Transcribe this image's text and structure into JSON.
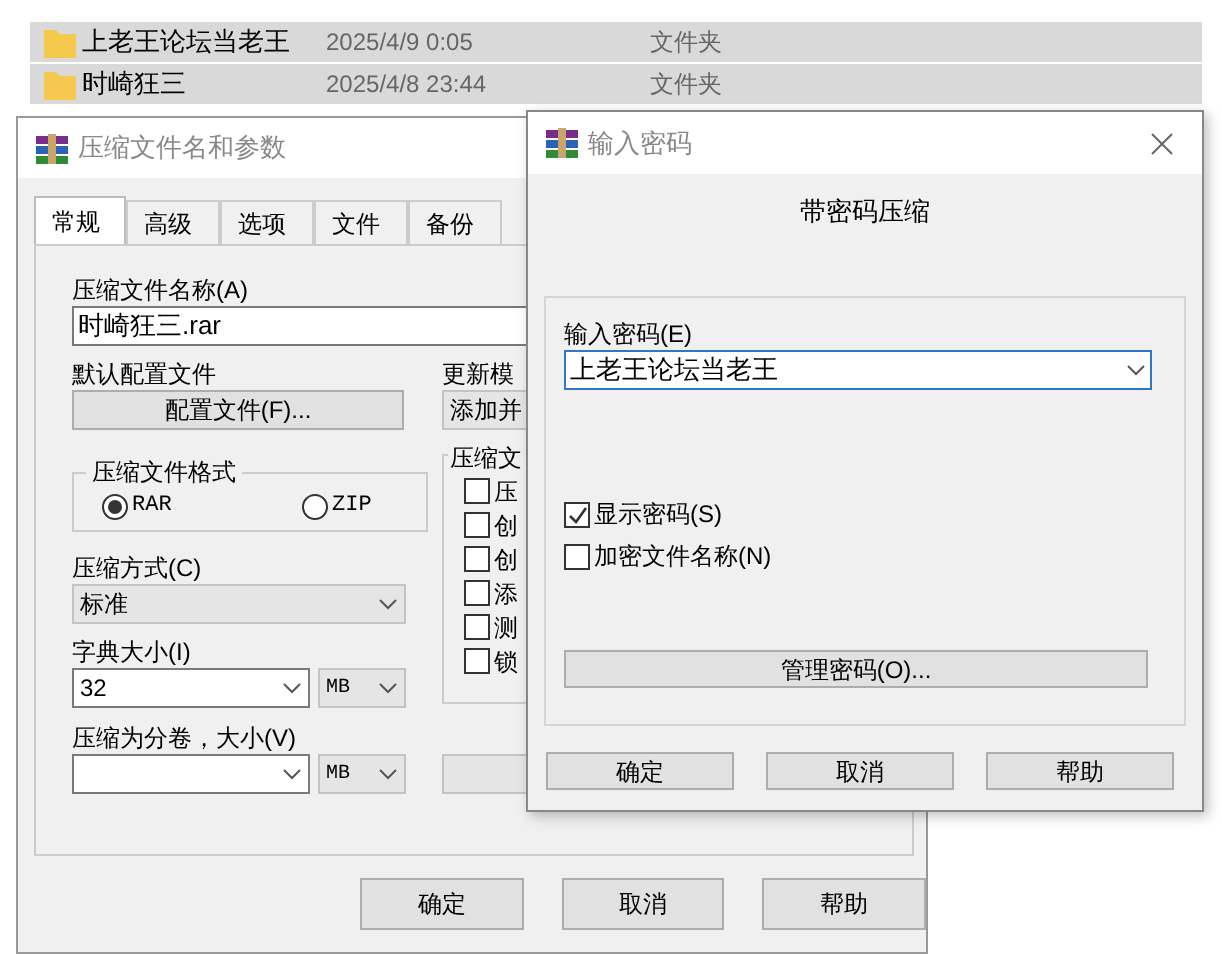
{
  "file_list": [
    {
      "name": "上老王论坛当老王",
      "modified": "2025/4/9 0:05",
      "type": "文件夹",
      "selected": true
    },
    {
      "name": "时崎狂三",
      "modified": "2025/4/8 23:44",
      "type": "文件夹",
      "selected": true
    }
  ],
  "archive_dialog": {
    "title": "压缩文件名和参数",
    "tabs": [
      {
        "label": "常规",
        "selected": true
      },
      {
        "label": "高级",
        "selected": false
      },
      {
        "label": "选项",
        "selected": false
      },
      {
        "label": "文件",
        "selected": false
      },
      {
        "label": "备份",
        "selected": false
      }
    ],
    "archive_name_label": "压缩文件名称(A)",
    "archive_name": "时崎狂三.rar",
    "profile_label": "默认配置文件",
    "profile_button": "配置文件(F)...",
    "update_mode_label": "更新模",
    "update_mode": "添加并",
    "format_group": {
      "label": "压缩文件格式",
      "options": [
        {
          "label": "RAR",
          "selected": true
        },
        {
          "label": "ZIP",
          "selected": false
        }
      ]
    },
    "method_label": "压缩方式(C)",
    "method": "标准",
    "dictionary_label": "字典大小(I)",
    "dictionary": "32",
    "dictionary_unit": "MB",
    "volume_label": "压缩为分卷，大小(V)",
    "volume_unit": "MB",
    "options_group": {
      "label": "压缩文",
      "items": [
        {
          "label": "压",
          "checked": false
        },
        {
          "label": "创",
          "checked": false
        },
        {
          "label": "创",
          "checked": false
        },
        {
          "label": "添",
          "checked": false
        },
        {
          "label": "测",
          "checked": false
        },
        {
          "label": "锁",
          "checked": false
        }
      ]
    },
    "buttons": [
      "确定",
      "取消",
      "帮助"
    ]
  },
  "password_dialog": {
    "title": "输入密码",
    "heading": "带密码压缩",
    "password_label": "输入密码(E)",
    "password": "上老王论坛当老王",
    "options": [
      {
        "label": "显示密码(S)",
        "checked": true
      },
      {
        "label": "加密文件名称(N)",
        "checked": false
      }
    ],
    "manage_button": "管理密码(O)...",
    "buttons": [
      "确定",
      "取消",
      "帮助"
    ]
  }
}
